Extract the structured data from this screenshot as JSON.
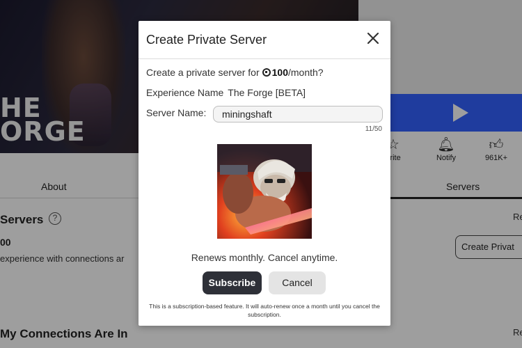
{
  "background": {
    "hero_title_line1": "HE",
    "hero_title_line2": "ORGE",
    "actions": [
      {
        "label": "orite",
        "icon": "star-icon"
      },
      {
        "label": "Notify",
        "icon": "bell-icon"
      },
      {
        "label": "961K+",
        "icon": "thumbs-up-icon"
      }
    ],
    "tabs": {
      "about": "About",
      "servers": "Servers"
    },
    "section_title": "Servers",
    "count_text": "00",
    "desc_text": "experience with connections ar",
    "right_text": "Re",
    "create_button": "Create Privat",
    "section2_title": "My Connections Are In",
    "right_text2": "Re"
  },
  "modal": {
    "title": "Create Private Server",
    "line1_prefix": "Create a private server for",
    "price": "100",
    "line1_suffix": "/month?",
    "experience_label": "Experience Name",
    "experience_value": "The Forge [BETA]",
    "server_label": "Server Name:",
    "server_value": "miningshaft",
    "char_count": "11/50",
    "renew_text": "Renews monthly. Cancel anytime.",
    "subscribe_label": "Subscribe",
    "cancel_label": "Cancel",
    "fine_print": "This is a subscription-based feature. It will auto-renew once a month until you cancel the subscription."
  },
  "colors": {
    "play_bar": "#3361ff",
    "subscribe_bg": "#2e3038",
    "cancel_bg": "#e4e4e4"
  }
}
